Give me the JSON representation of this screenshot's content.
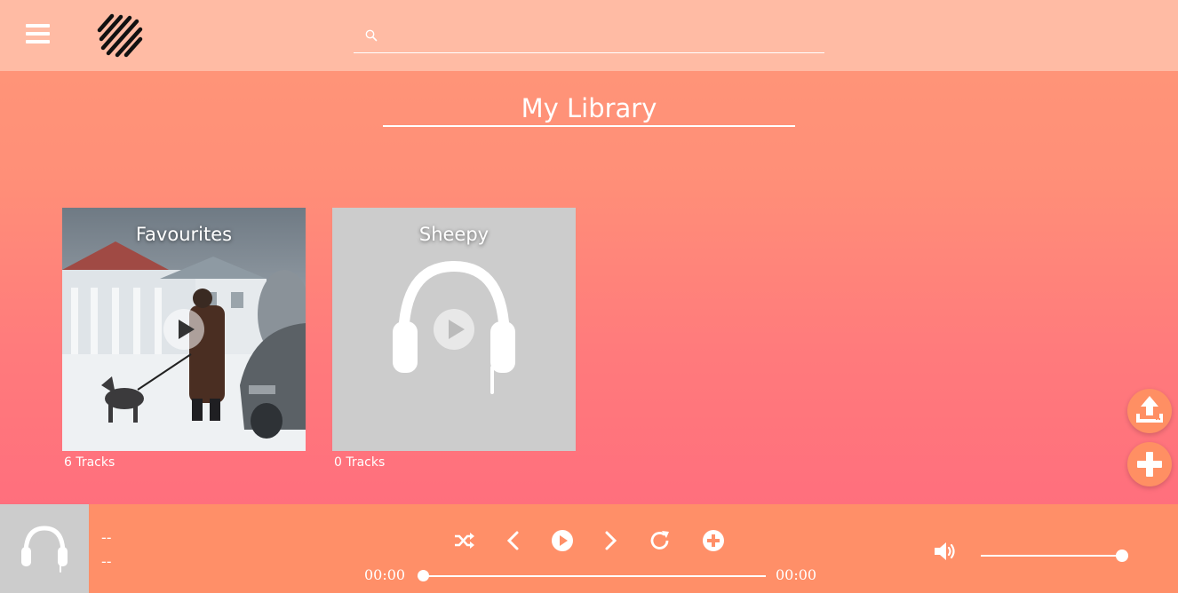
{
  "header": {
    "menu_icon": "hamburger-icon",
    "logo_icon": "stripes-logo",
    "search": {
      "placeholder": "",
      "value": "",
      "icon": "search-icon"
    }
  },
  "page": {
    "title": "My Library"
  },
  "playlists": [
    {
      "title": "Favourites",
      "track_count": "6 Tracks",
      "artwork": "album-photo",
      "play_icon": "play-circle-icon"
    },
    {
      "title": "Sheepy",
      "track_count": "0 Tracks",
      "artwork": "headphones-placeholder-icon",
      "play_icon": "play-circle-icon"
    }
  ],
  "actions": {
    "upload_icon": "upload-icon",
    "add_icon": "plus-icon"
  },
  "player": {
    "artwork": "headphones-icon",
    "track_title": "--",
    "track_artist": "--",
    "controls": [
      "shuffle-icon",
      "previous-icon",
      "play-icon",
      "next-icon",
      "repeat-icon",
      "add-circle-icon"
    ],
    "current_time": "00:00",
    "total_time": "00:00",
    "progress": 0,
    "volume": 1.0
  },
  "colors": {
    "header_bg": "#ffbba4",
    "player_bg": "#ff8f68",
    "fab_bg": "#ff8f63",
    "placeholder_bg": "#cccccc"
  }
}
